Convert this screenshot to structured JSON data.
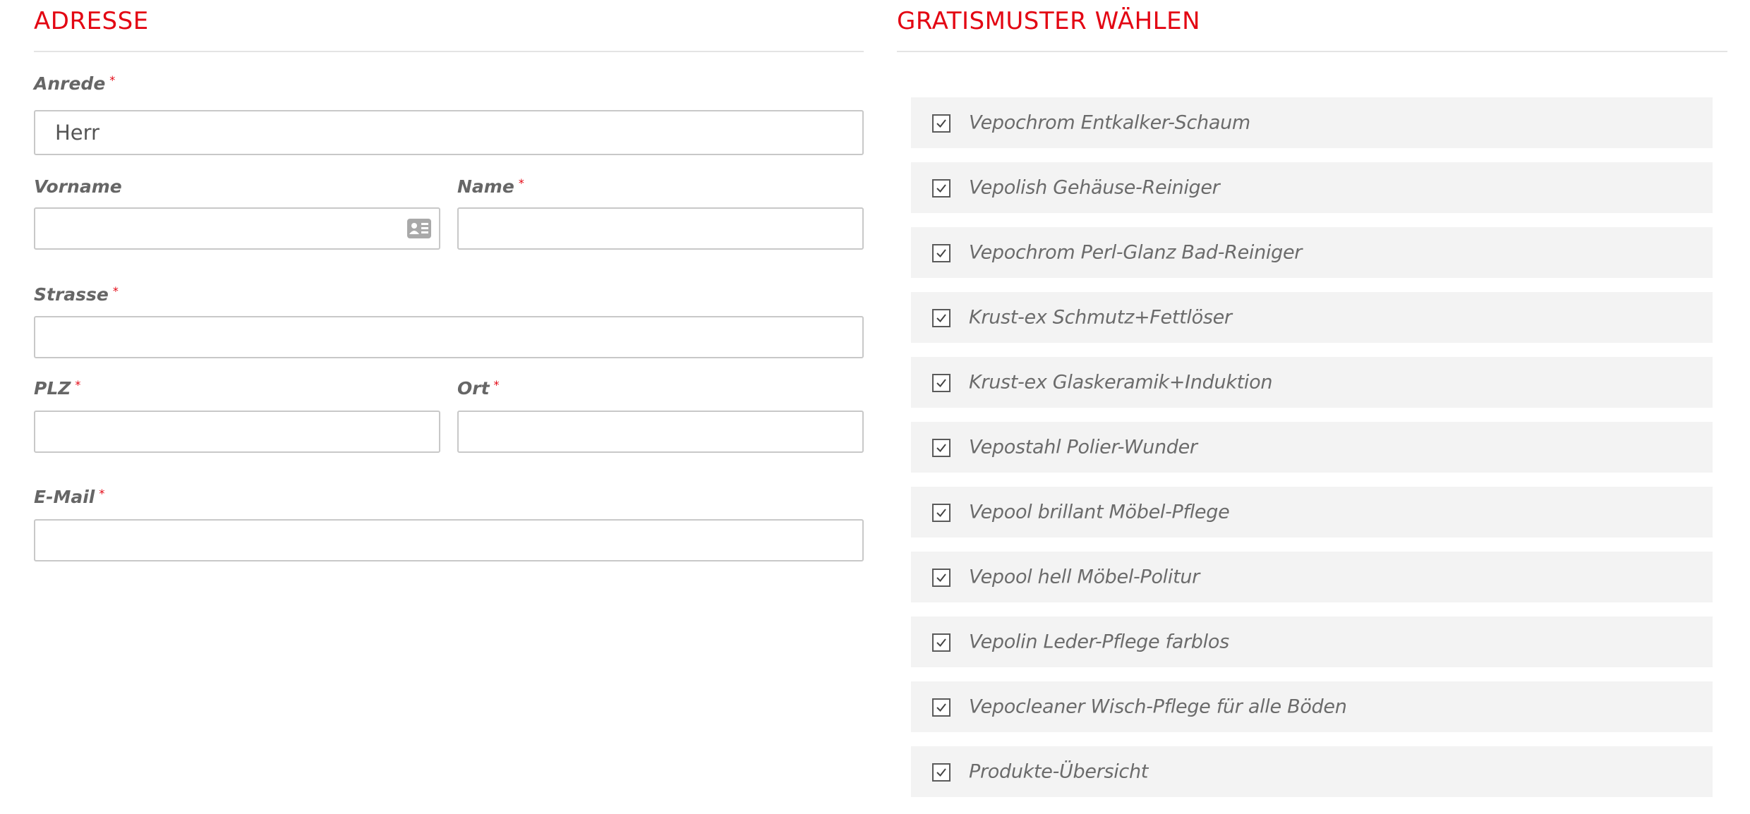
{
  "address": {
    "title": "ADRESSE",
    "required_mark": "*",
    "fields": {
      "salutation": {
        "label": "Anrede",
        "required": true,
        "value": "Herr"
      },
      "first_name": {
        "label": "Vorname",
        "required": false,
        "value": ""
      },
      "last_name": {
        "label": "Name",
        "required": true,
        "value": ""
      },
      "street": {
        "label": "Strasse",
        "required": true,
        "value": ""
      },
      "zip": {
        "label": "PLZ",
        "required": true,
        "value": ""
      },
      "city": {
        "label": "Ort",
        "required": true,
        "value": ""
      },
      "email": {
        "label": "E-Mail",
        "required": true,
        "value": ""
      }
    }
  },
  "samples": {
    "title": "GRATISMUSTER WÄHLEN",
    "items": [
      {
        "label": "Vepochrom Entkalker-Schaum",
        "checked": true
      },
      {
        "label": "Vepolish Gehäuse-Reiniger",
        "checked": true
      },
      {
        "label": "Vepochrom Perl-Glanz Bad-Reiniger",
        "checked": true
      },
      {
        "label": "Krust-ex Schmutz+Fettlöser",
        "checked": true
      },
      {
        "label": "Krust-ex Glaskeramik+Induktion",
        "checked": true
      },
      {
        "label": "Vepostahl Polier-Wunder",
        "checked": true
      },
      {
        "label": "Vepool brillant Möbel-Pflege",
        "checked": true
      },
      {
        "label": "Vepool hell Möbel-Politur",
        "checked": true
      },
      {
        "label": "Vepolin Leder-Pflege farblos",
        "checked": true
      },
      {
        "label": "Vepocleaner Wisch-Pflege für alle Böden",
        "checked": true
      },
      {
        "label": "Produkte-Übersicht",
        "checked": true
      }
    ]
  },
  "colors": {
    "accent": "#e30613",
    "input_border": "#c8c8c8",
    "item_background": "#f3f3f3",
    "label_text": "#666666"
  },
  "icons": {
    "autofill": "contact-card-icon",
    "checkbox": "check-icon"
  }
}
